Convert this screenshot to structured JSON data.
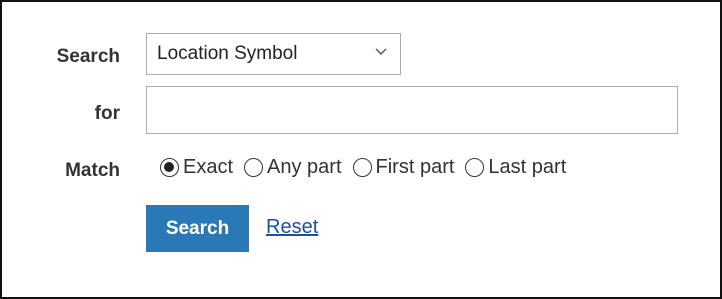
{
  "form": {
    "search_label": "Search",
    "search_type": {
      "selected": "Location Symbol"
    },
    "for_label": "for",
    "for_value": "",
    "match_label": "Match",
    "match_options": [
      {
        "label": "Exact",
        "checked": true
      },
      {
        "label": "Any part",
        "checked": false
      },
      {
        "label": "First part",
        "checked": false
      },
      {
        "label": "Last part",
        "checked": false
      }
    ],
    "search_button": "Search",
    "reset_link": "Reset"
  },
  "colors": {
    "button_bg": "#2b78b6",
    "link": "#1f4fa0",
    "frame_border": "#111111"
  }
}
